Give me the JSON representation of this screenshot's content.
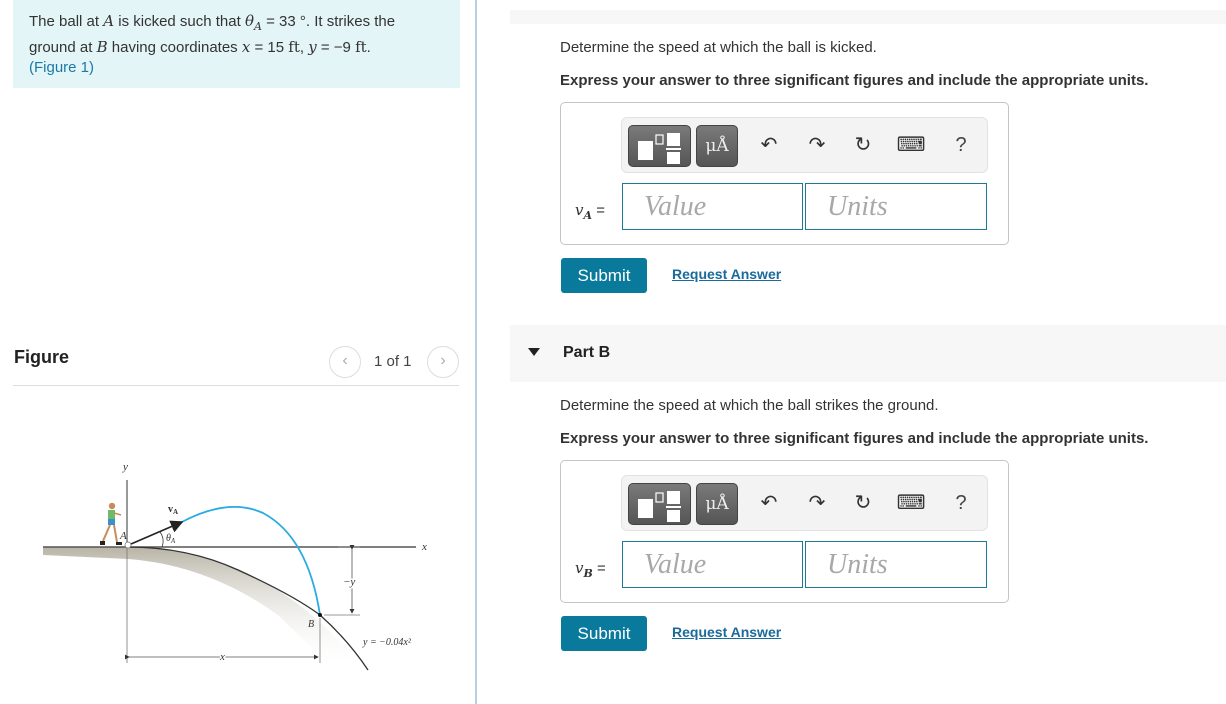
{
  "intro": {
    "t1": "The ball at ",
    "A": "A",
    "t2": " is kicked such that ",
    "theta": "θ",
    "theta_sub": "A",
    "t3": " = 33 °. It strikes the ground at ",
    "B": "B",
    "t4": " having coordinates ",
    "x": "x",
    "t5": " = 15 ",
    "ft1": "ft",
    "t6": ", ",
    "y": "y",
    "t7": " = −9 ",
    "ft2": "ft",
    "t8": ".",
    "figure_link": "(Figure 1)"
  },
  "figure_panel": {
    "title": "Figure",
    "pager_prev": "‹",
    "pager_next": "›",
    "pager_text": "1 of 1"
  },
  "diagram": {
    "label_y_axis": "y",
    "label_x_axis": "x",
    "label_A": "A",
    "label_B": "B",
    "label_vA": "v",
    "label_vA_sub": "A",
    "label_theta": "θ",
    "label_theta_sub": "A",
    "label_neg_y": "−y",
    "label_x_dim": "x",
    "label_curve": "y = −0.04x²"
  },
  "partA": {
    "prompt": "Determine the speed at which the ball is kicked.",
    "instruction": "Express your answer to three significant figures and include the appropriate units.",
    "var": "v",
    "var_sub": "A",
    "eq": " =",
    "value_placeholder": "Value",
    "units_placeholder": "Units",
    "submit": "Submit",
    "request": "Request Answer"
  },
  "partB": {
    "title": "Part B",
    "prompt": "Determine the speed at which the ball strikes the ground.",
    "instruction": "Express your answer to three significant figures and include the appropriate units.",
    "var": "v",
    "var_sub": "B",
    "eq": " =",
    "value_placeholder": "Value",
    "units_placeholder": "Units",
    "submit": "Submit",
    "request": "Request Answer"
  },
  "toolbar": {
    "units_glyph": "μÅ",
    "undo_glyph": "↶",
    "redo_glyph": "↷",
    "reset_glyph": "↻",
    "keyboard_glyph": "⌨",
    "help_glyph": "?"
  },
  "colors": {
    "accent": "#0a7a9c",
    "intro_bg": "#e4f5f7",
    "trajectory": "#29abe2"
  }
}
